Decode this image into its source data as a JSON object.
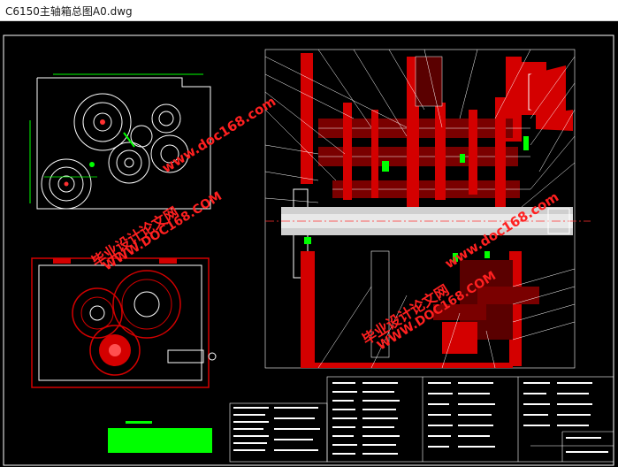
{
  "window": {
    "title": "C6150主轴箱总图A0.dwg"
  },
  "watermarks": {
    "site_1": "www.doc168.com",
    "cn_1": "毕业设计论文网",
    "url_1": "WWW.DOC168.COM",
    "site_2": "www.doc168.com",
    "cn_2": "毕业设计论文网",
    "url_2": "WWW.DOC168.COM"
  },
  "colors": {
    "background": "#000000",
    "frame": "#ffffff",
    "red": "#d40000",
    "green": "#00ff00",
    "watermark": "#ff2020"
  }
}
